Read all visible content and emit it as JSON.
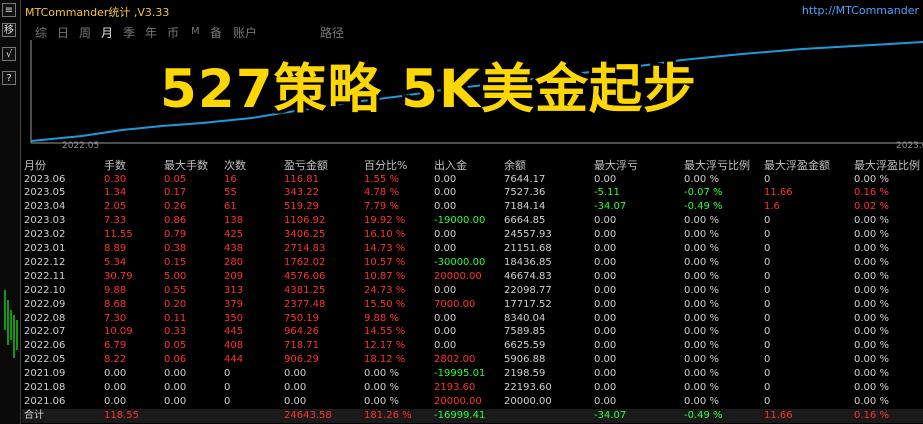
{
  "window": {
    "title": "MTCommander统计 ,V3.33",
    "url": "http://MTCommander"
  },
  "toolbar": {
    "buttons": [
      {
        "label": "≡",
        "icon": "menu-icon"
      },
      {
        "label": "移",
        "icon": "move-icon"
      },
      {
        "label": "√",
        "icon": "check-icon"
      },
      {
        "label": "?",
        "icon": "help-icon"
      }
    ]
  },
  "tabs": [
    {
      "label": "综",
      "active": false
    },
    {
      "label": "日",
      "active": false
    },
    {
      "label": "周",
      "active": false
    },
    {
      "label": "月",
      "active": true
    },
    {
      "label": "季",
      "active": false
    },
    {
      "label": "年",
      "active": false
    },
    {
      "label": "币",
      "active": false
    },
    {
      "label": "M",
      "active": false
    },
    {
      "label": "备",
      "active": false
    },
    {
      "label": "账户",
      "active": false
    },
    {
      "label": "路径",
      "active": false
    }
  ],
  "chart": {
    "banner": "527策略 5K美金起步",
    "x_start_label": "2022.05",
    "x_end_label": "2023.0",
    "line_color": "#1e9bd7"
  },
  "table": {
    "headers": [
      "月份",
      "手数",
      "最大手数",
      "次数",
      "盈亏金额",
      "百分比%",
      "出入金",
      "余额",
      "最大浮亏",
      "最大浮亏比例",
      "最大浮盈金额",
      "最大浮盈比例"
    ],
    "rows": [
      [
        "2023.06",
        "0.30",
        "0.05",
        "16",
        "116.81",
        "1.55 %",
        "0.00",
        "7644.17",
        "0.00",
        "0.00 %",
        "0",
        "0.00 %"
      ],
      [
        "2023.05",
        "1.34",
        "0.17",
        "55",
        "343.22",
        "4.78 %",
        "0.00",
        "7527.36",
        "-5.11",
        "-0.07 %",
        "11.66",
        "0.16 %"
      ],
      [
        "2023.04",
        "2.05",
        "0.26",
        "61",
        "519.29",
        "7.79 %",
        "0.00",
        "7184.14",
        "-34.07",
        "-0.49 %",
        "1.6",
        "0.02 %"
      ],
      [
        "2023.03",
        "7.33",
        "0.86",
        "138",
        "1106.92",
        "19.92 %",
        "-19000.00",
        "6664.85",
        "0.00",
        "0.00 %",
        "0",
        "0.00 %"
      ],
      [
        "2023.02",
        "11.55",
        "0.79",
        "425",
        "3406.25",
        "16.10 %",
        "0.00",
        "24557.93",
        "0.00",
        "0.00 %",
        "0",
        "0.00 %"
      ],
      [
        "2023.01",
        "8.89",
        "0.38",
        "438",
        "2714.83",
        "14.73 %",
        "0.00",
        "21151.68",
        "0.00",
        "0.00 %",
        "0",
        "0.00 %"
      ],
      [
        "2022.12",
        "5.34",
        "0.15",
        "280",
        "1762.02",
        "10.57 %",
        "-30000.00",
        "18436.85",
        "0.00",
        "0.00 %",
        "0",
        "0.00 %"
      ],
      [
        "2022.11",
        "30.79",
        "5.00",
        "209",
        "4576.06",
        "10.87 %",
        "20000.00",
        "46674.83",
        "0.00",
        "0.00 %",
        "0",
        "0.00 %"
      ],
      [
        "2022.10",
        "9.88",
        "0.55",
        "313",
        "4381.25",
        "24.73 %",
        "0.00",
        "22098.77",
        "0.00",
        "0.00 %",
        "0",
        "0.00 %"
      ],
      [
        "2022.09",
        "8.68",
        "0.20",
        "379",
        "2377.48",
        "15.50 %",
        "7000.00",
        "17717.52",
        "0.00",
        "0.00 %",
        "0",
        "0.00 %"
      ],
      [
        "2022.08",
        "7.30",
        "0.11",
        "350",
        "750.19",
        "9.88 %",
        "0.00",
        "8340.04",
        "0.00",
        "0.00 %",
        "0",
        "0.00 %"
      ],
      [
        "2022.07",
        "10.09",
        "0.33",
        "445",
        "964.26",
        "14.55 %",
        "0.00",
        "7589.85",
        "0.00",
        "0.00 %",
        "0",
        "0.00 %"
      ],
      [
        "2022.06",
        "6.79",
        "0.05",
        "408",
        "718.71",
        "12.17 %",
        "0.00",
        "6625.59",
        "0.00",
        "0.00 %",
        "0",
        "0.00 %"
      ],
      [
        "2022.05",
        "8.22",
        "0.06",
        "444",
        "906.29",
        "18.12 %",
        "2802.00",
        "5906.88",
        "0.00",
        "0.00 %",
        "0",
        "0.00 %"
      ],
      [
        "2021.09",
        "0.00",
        "0.00",
        "0",
        "0.00",
        "0.00 %",
        "-19995.01",
        "2198.59",
        "0.00",
        "0.00 %",
        "0",
        "0.00 %"
      ],
      [
        "2021.08",
        "0.00",
        "0.00",
        "0",
        "0.00",
        "0.00 %",
        "2193.60",
        "22193.60",
        "0.00",
        "0.00 %",
        "0",
        "0.00 %"
      ],
      [
        "2021.06",
        "0.00",
        "0.00",
        "0",
        "0.00",
        "0.00 %",
        "20000.00",
        "20000.00",
        "0.00",
        "0.00 %",
        "0",
        "0.00 %"
      ]
    ],
    "row_colors": [
      [
        "w",
        "r",
        "r",
        "r",
        "r",
        "r",
        "w",
        "w",
        "w",
        "w",
        "w",
        "w"
      ],
      [
        "w",
        "r",
        "r",
        "r",
        "r",
        "r",
        "w",
        "w",
        "g",
        "g",
        "r",
        "r"
      ],
      [
        "w",
        "r",
        "r",
        "r",
        "r",
        "r",
        "w",
        "w",
        "g",
        "g",
        "r",
        "r"
      ],
      [
        "w",
        "r",
        "r",
        "r",
        "r",
        "r",
        "g",
        "w",
        "w",
        "w",
        "w",
        "w"
      ],
      [
        "w",
        "r",
        "r",
        "r",
        "r",
        "r",
        "w",
        "w",
        "w",
        "w",
        "w",
        "w"
      ],
      [
        "w",
        "r",
        "r",
        "r",
        "r",
        "r",
        "w",
        "w",
        "w",
        "w",
        "w",
        "w"
      ],
      [
        "w",
        "r",
        "r",
        "r",
        "r",
        "r",
        "g",
        "w",
        "w",
        "w",
        "w",
        "w"
      ],
      [
        "w",
        "r",
        "r",
        "r",
        "r",
        "r",
        "r",
        "w",
        "w",
        "w",
        "w",
        "w"
      ],
      [
        "w",
        "r",
        "r",
        "r",
        "r",
        "r",
        "w",
        "w",
        "w",
        "w",
        "w",
        "w"
      ],
      [
        "w",
        "r",
        "r",
        "r",
        "r",
        "r",
        "r",
        "w",
        "w",
        "w",
        "w",
        "w"
      ],
      [
        "w",
        "r",
        "r",
        "r",
        "r",
        "r",
        "w",
        "w",
        "w",
        "w",
        "w",
        "w"
      ],
      [
        "w",
        "r",
        "r",
        "r",
        "r",
        "r",
        "w",
        "w",
        "w",
        "w",
        "w",
        "w"
      ],
      [
        "w",
        "r",
        "r",
        "r",
        "r",
        "r",
        "w",
        "w",
        "w",
        "w",
        "w",
        "w"
      ],
      [
        "w",
        "r",
        "r",
        "r",
        "r",
        "r",
        "r",
        "w",
        "w",
        "w",
        "w",
        "w"
      ],
      [
        "w",
        "w",
        "w",
        "w",
        "w",
        "w",
        "g",
        "w",
        "w",
        "w",
        "w",
        "w"
      ],
      [
        "w",
        "w",
        "w",
        "w",
        "w",
        "w",
        "r",
        "w",
        "w",
        "w",
        "w",
        "w"
      ],
      [
        "w",
        "w",
        "w",
        "w",
        "w",
        "w",
        "r",
        "w",
        "w",
        "w",
        "w",
        "w"
      ]
    ],
    "total": [
      "合计",
      "118.55",
      "",
      "",
      "24643.58",
      "181.26 %",
      "-16999.41",
      "",
      "-34.07",
      "-0.49 %",
      "11.66",
      "0.16 %"
    ],
    "total_colors": [
      "w",
      "r",
      "w",
      "w",
      "r",
      "r",
      "g",
      "w",
      "g",
      "g",
      "r",
      "r"
    ]
  }
}
